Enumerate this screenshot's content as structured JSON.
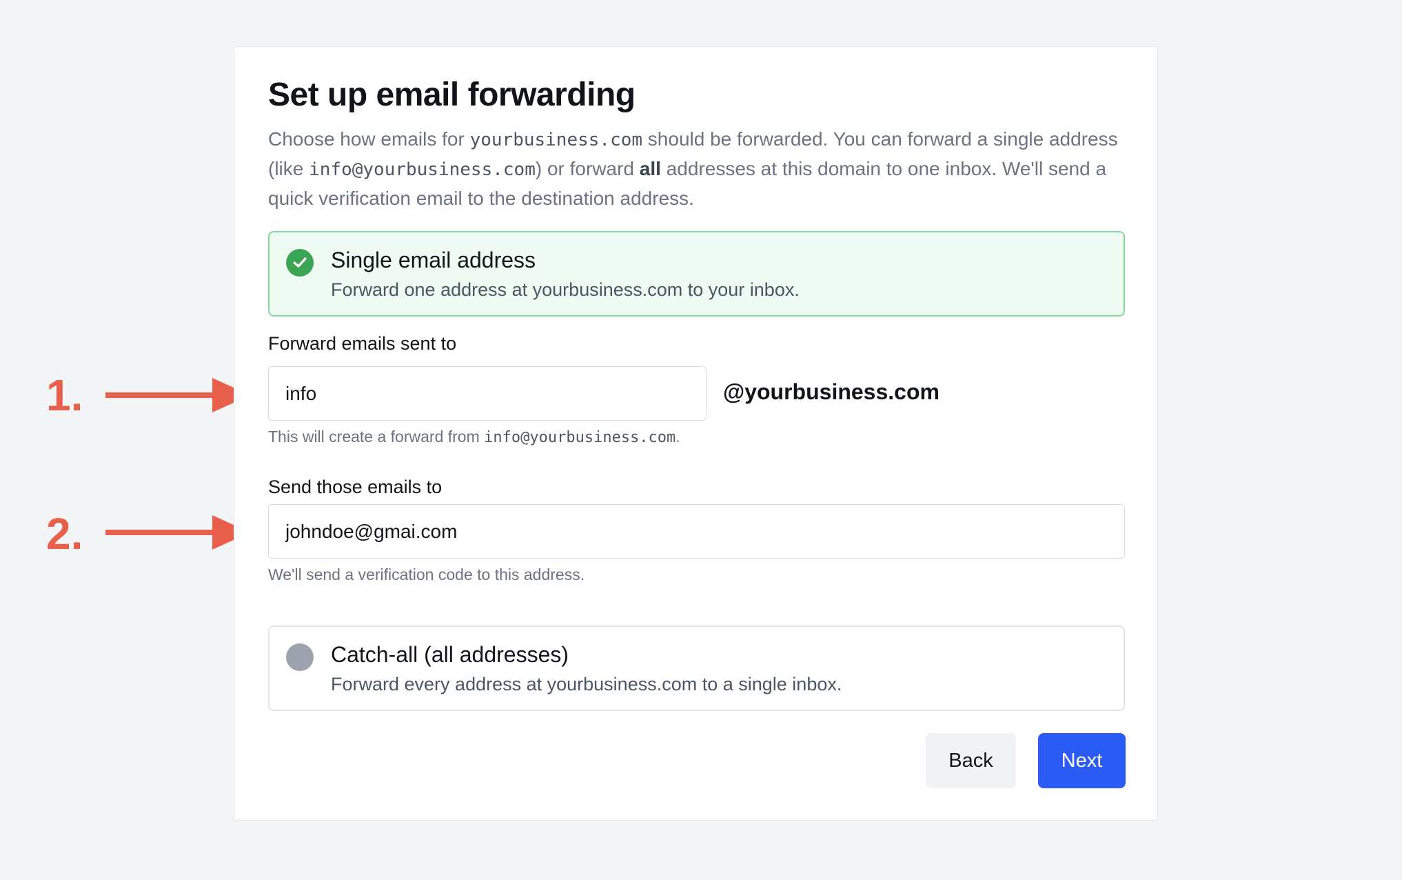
{
  "page": {
    "title": "Set up email forwarding",
    "intro": {
      "part1": "Choose how emails for ",
      "domain_mono": "yourbusiness.com",
      "part2": " should be forwarded. You can forward a single address (like ",
      "example_mono": "info@yourbusiness.com",
      "part3": ") or forward ",
      "bold_word": "all",
      "part4": " addresses at this domain to one inbox. We'll send a quick verification email to the destination address."
    }
  },
  "options": {
    "single": {
      "title": "Single email address",
      "description": "Forward one address at yourbusiness.com to your inbox.",
      "selected": true
    },
    "catch_all": {
      "title": "Catch-all (all addresses)",
      "description": "Forward every address at yourbusiness.com to a single inbox.",
      "selected": false
    }
  },
  "forward_from": {
    "label": "Forward emails sent to",
    "value": "info",
    "domain_suffix": "@yourbusiness.com",
    "hint_prefix": "This will create a forward from ",
    "hint_mono": "info@yourbusiness.com",
    "hint_suffix": "."
  },
  "forward_to": {
    "label": "Send those emails to",
    "value": "johndoe@gmai.com",
    "hint": "We'll send a verification code to this address."
  },
  "buttons": {
    "back": "Back",
    "next": "Next"
  },
  "annotations": {
    "step1": "1.",
    "step2": "2."
  },
  "colors": {
    "accent": "#2b5cf5",
    "success": "#3aa655",
    "selected_bg": "#f0fbf3",
    "annotation": "#e8604c"
  },
  "icons": {
    "selected_radio": "check-circle-icon",
    "unselected_radio": "radio-empty-icon",
    "annotation_arrow": "arrow-right-icon"
  }
}
